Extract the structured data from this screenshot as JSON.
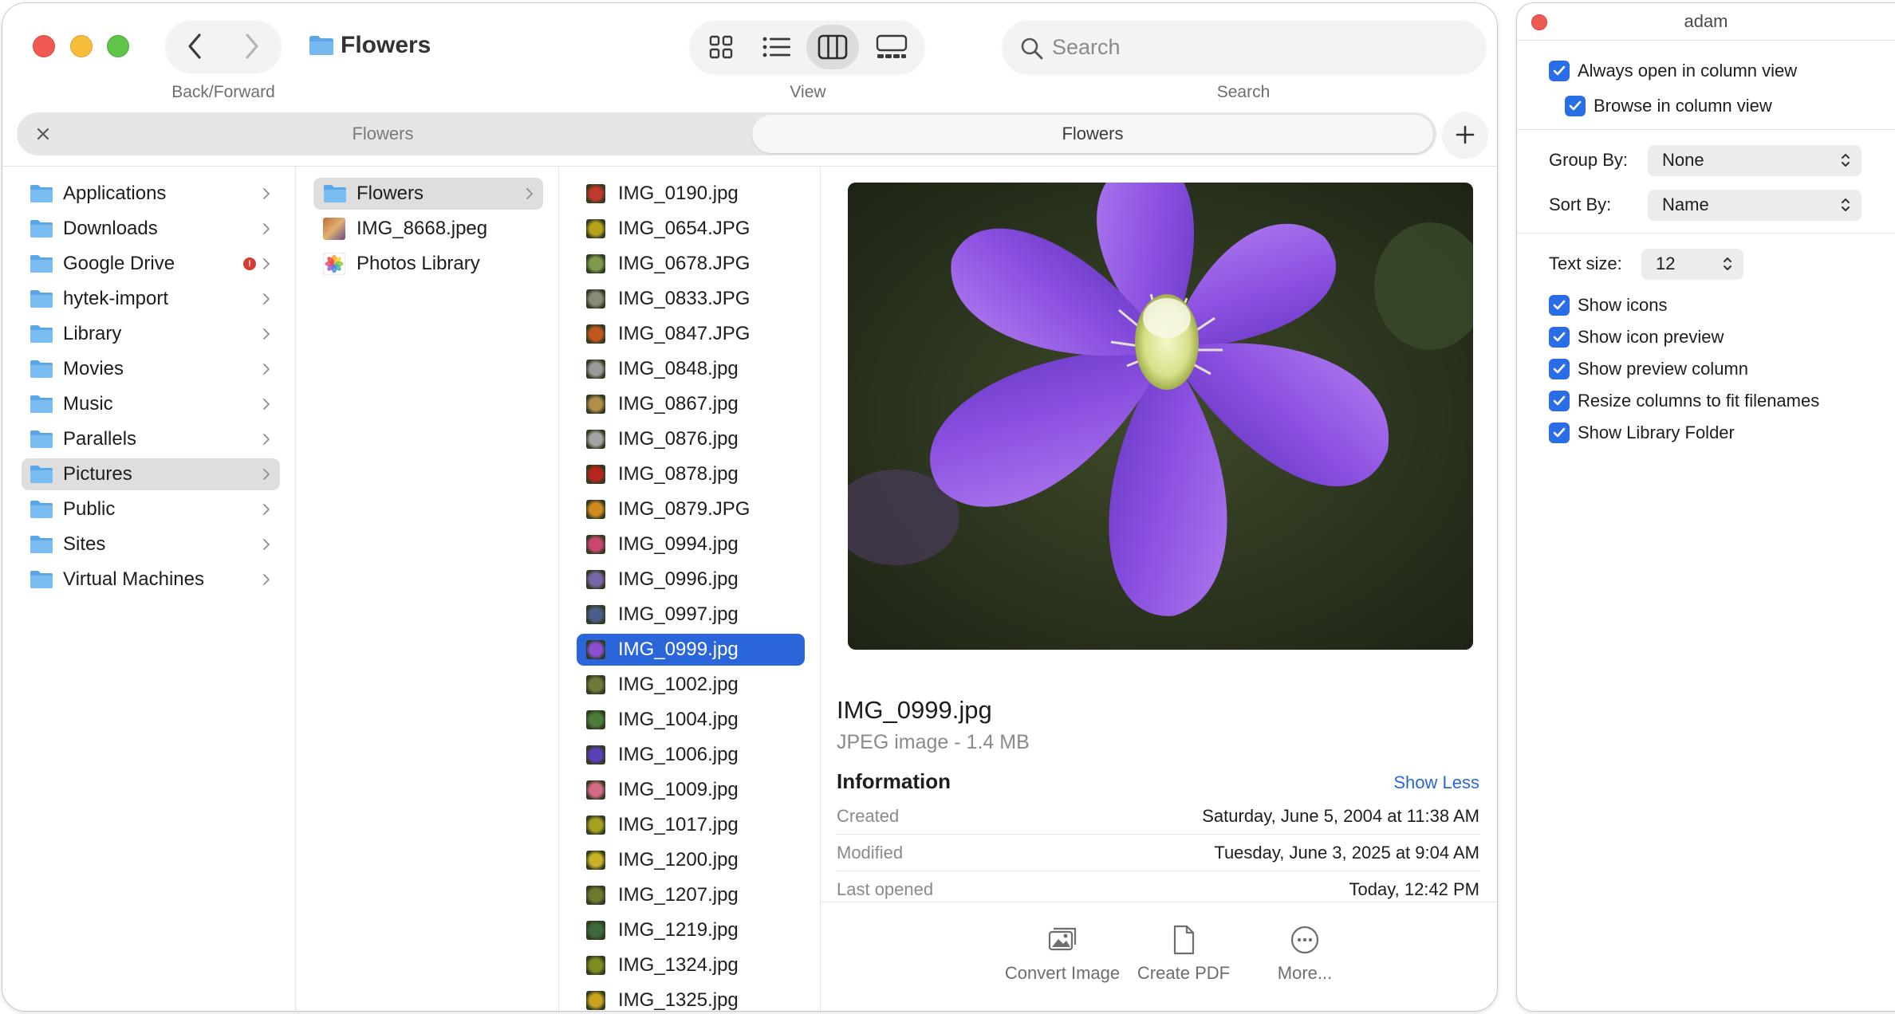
{
  "window": {
    "title": "Flowers",
    "captions": {
      "nav": "Back/Forward",
      "view": "View",
      "search": "Search"
    }
  },
  "search": {
    "placeholder": "Search",
    "value": ""
  },
  "tabs": [
    {
      "label": "Flowers",
      "active": false
    },
    {
      "label": "Flowers",
      "active": true
    }
  ],
  "sidebar": {
    "items": [
      {
        "label": "Applications",
        "icon": "applications-folder-icon",
        "selected": false
      },
      {
        "label": "Downloads",
        "icon": "downloads-folder-icon",
        "selected": false
      },
      {
        "label": "Google Drive",
        "icon": "google-drive-folder-icon",
        "selected": false,
        "badge": "!"
      },
      {
        "label": "hytek-import",
        "icon": "folder-icon",
        "selected": false
      },
      {
        "label": "Library",
        "icon": "library-folder-icon",
        "selected": false
      },
      {
        "label": "Movies",
        "icon": "movies-folder-icon",
        "selected": false
      },
      {
        "label": "Music",
        "icon": "music-folder-icon",
        "selected": false
      },
      {
        "label": "Parallels",
        "icon": "folder-icon",
        "selected": false
      },
      {
        "label": "Pictures",
        "icon": "pictures-folder-icon",
        "selected": true
      },
      {
        "label": "Public",
        "icon": "public-folder-icon",
        "selected": false
      },
      {
        "label": "Sites",
        "icon": "sites-folder-icon",
        "selected": false
      },
      {
        "label": "Virtual Machines",
        "icon": "folder-icon",
        "selected": false
      }
    ]
  },
  "pictures_column": {
    "items": [
      {
        "label": "Flowers",
        "icon": "folder-icon",
        "selected": true
      },
      {
        "label": "IMG_8668.jpeg",
        "icon": "image-thumbnail-icon",
        "selected": false
      },
      {
        "label": "Photos Library",
        "icon": "photos-library-icon",
        "selected": false
      }
    ]
  },
  "flowers_column": {
    "items": [
      {
        "label": "IMG_0190.jpg",
        "color": "#c0392b"
      },
      {
        "label": "IMG_0654.JPG",
        "color": "#b5a21a"
      },
      {
        "label": "IMG_0678.JPG",
        "color": "#7f9a4e"
      },
      {
        "label": "IMG_0833.JPG",
        "color": "#8a8a7a"
      },
      {
        "label": "IMG_0847.JPG",
        "color": "#c2571d"
      },
      {
        "label": "IMG_0848.jpg",
        "color": "#9a9a9a"
      },
      {
        "label": "IMG_0867.jpg",
        "color": "#b38d4a"
      },
      {
        "label": "IMG_0876.jpg",
        "color": "#a4a4a4"
      },
      {
        "label": "IMG_0878.jpg",
        "color": "#b7261e"
      },
      {
        "label": "IMG_0879.JPG",
        "color": "#d08a1e"
      },
      {
        "label": "IMG_0994.jpg",
        "color": "#c9476f"
      },
      {
        "label": "IMG_0996.jpg",
        "color": "#7a64a8"
      },
      {
        "label": "IMG_0997.jpg",
        "color": "#4a5c8a"
      },
      {
        "label": "IMG_0999.jpg",
        "color": "#8a4fd0",
        "selected": true
      },
      {
        "label": "IMG_1002.jpg",
        "color": "#6e7a3c"
      },
      {
        "label": "IMG_1004.jpg",
        "color": "#4b7d3a"
      },
      {
        "label": "IMG_1006.jpg",
        "color": "#5b3fb8"
      },
      {
        "label": "IMG_1009.jpg",
        "color": "#d46a86"
      },
      {
        "label": "IMG_1017.jpg",
        "color": "#a8a020"
      },
      {
        "label": "IMG_1200.jpg",
        "color": "#c9b227"
      },
      {
        "label": "IMG_1207.jpg",
        "color": "#6d7a2e"
      },
      {
        "label": "IMG_1219.jpg",
        "color": "#3c6a3a"
      },
      {
        "label": "IMG_1324.jpg",
        "color": "#7e8c20"
      },
      {
        "label": "IMG_1325.jpg",
        "color": "#c9a21e"
      }
    ]
  },
  "preview": {
    "file_name": "IMG_0999.jpg",
    "file_kind": "JPEG image - 1.4 MB",
    "info_title": "Information",
    "show_less": "Show Less",
    "info": [
      {
        "key": "Created",
        "value": "Saturday, June 5, 2004 at 11:38 AM"
      },
      {
        "key": "Modified",
        "value": "Tuesday, June 3, 2025 at 9:04 AM"
      },
      {
        "key": "Last opened",
        "value": "Today, 12:42 PM"
      }
    ],
    "actions": [
      {
        "label": "Convert Image",
        "icon": "convert-image-icon"
      },
      {
        "label": "Create PDF",
        "icon": "create-pdf-icon"
      },
      {
        "label": "More...",
        "icon": "more-icon"
      }
    ]
  },
  "view_options": {
    "title": "adam",
    "always_open": "Always open in column view",
    "browse_in": "Browse in column view",
    "group_by_label": "Group By:",
    "group_by_value": "None",
    "sort_by_label": "Sort By:",
    "sort_by_value": "Name",
    "text_size_label": "Text size:",
    "text_size_value": "12",
    "options": [
      "Show icons",
      "Show icon preview",
      "Show preview column",
      "Resize columns to fit filenames",
      "Show Library Folder"
    ]
  },
  "colors": {
    "accent": "#2a66d9",
    "checkbox": "#2a6ee6",
    "folder": "#5aa6e6",
    "close": "#ee5a52",
    "minimize": "#f6bd3b",
    "maximize": "#5fc549"
  }
}
